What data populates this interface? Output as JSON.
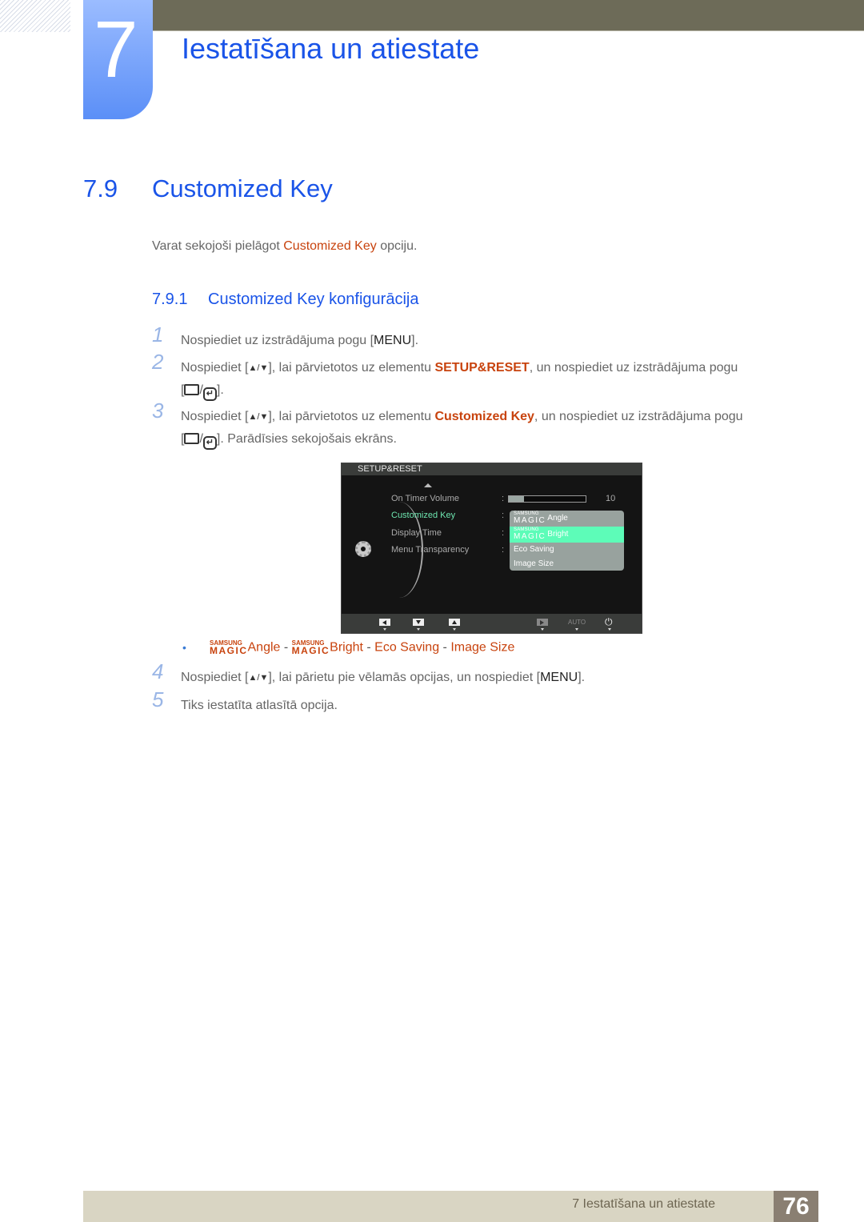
{
  "chapter": {
    "number": "7",
    "title": "Iestatīšana un atiestate"
  },
  "section": {
    "number": "7.9",
    "title": "Customized Key",
    "intro_before": "Varat sekojoši pielāgot ",
    "intro_highlight": "Customized Key",
    "intro_after": " opciju."
  },
  "subsection": {
    "number": "7.9.1",
    "title": "Customized Key konfigurācija"
  },
  "steps": [
    {
      "num": "1",
      "text_before": "Nospiediet uz izstrādājuma pogu [",
      "key": "MENU",
      "text_after": "]."
    },
    {
      "num": "2",
      "text_before": "Nospiediet [",
      "arrows": "▲/▼",
      "text_mid": "], lai pārvietotos uz elementu ",
      "highlight": "SETUP&RESET",
      "text_after": ", un nospiediet uz izstrādājuma pogu",
      "line2_after": "]."
    },
    {
      "num": "3",
      "text_before": "Nospiediet [",
      "arrows": "▲/▼",
      "text_mid": "], lai pārvietotos uz elementu ",
      "highlight": "Customized Key",
      "text_after": ", un nospiediet uz izstrādājuma pogu",
      "line2_after": "]. Parādīsies sekojošais ekrāns."
    },
    {
      "num": "4",
      "text_before": "Nospiediet [",
      "arrows": "▲/▼",
      "text_mid": "], lai pārietu pie vēlamās opcijas, un nospiediet [",
      "key": "MENU",
      "text_after": "]."
    },
    {
      "num": "5",
      "text": "Tiks iestatīta atlasītā opcija."
    }
  ],
  "osd": {
    "header": "SETUP&RESET",
    "items": [
      "On Timer  Volume",
      "Customized Key",
      "Display Time",
      "Menu Transparency"
    ],
    "active_item": "Customized Key",
    "volume_value": "10",
    "volume_fill_fraction": 0.2,
    "options": [
      {
        "brand_small": "SAMSUNG",
        "brand_big": "MAGIC",
        "label": "Angle"
      },
      {
        "brand_small": "SAMSUNG",
        "brand_big": "MAGIC",
        "label": "Bright"
      },
      {
        "label": "Eco Saving"
      },
      {
        "label": "Image Size"
      }
    ],
    "selected_option": "Bright",
    "footer_auto": "AUTO",
    "footer_power": "⏻"
  },
  "options_line": {
    "bullet": "•",
    "brand_small": "SAMSUNG",
    "brand_big": "MAGIC",
    "opt1": "Angle",
    "sep": " - ",
    "opt2": "Bright",
    "opt3": "Eco Saving",
    "opt4": "Image Size"
  },
  "footer": {
    "text": "7 Iestatīšana un atiestate",
    "page": "76"
  },
  "colors": {
    "title_blue": "#1a54e8",
    "highlight_orange": "#c8430e",
    "osd_select_green": "#5dfcb8"
  }
}
